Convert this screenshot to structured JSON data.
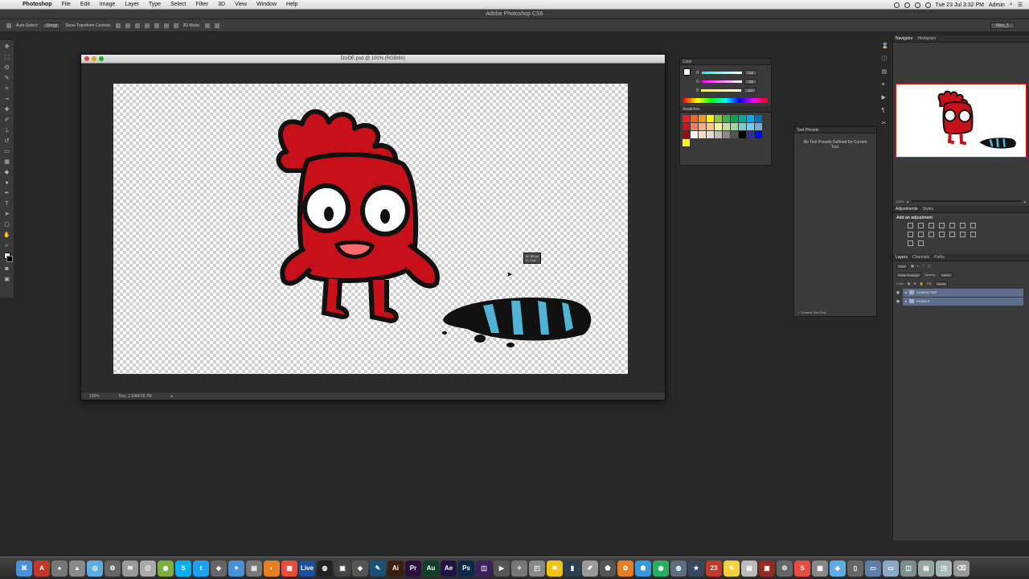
{
  "menubar": {
    "app_name": "Photoshop",
    "items": [
      "File",
      "Edit",
      "Image",
      "Layer",
      "Type",
      "Select",
      "Filter",
      "3D",
      "View",
      "Window",
      "Help"
    ],
    "clock": "Tue 23 Jul  3:32 PM",
    "user": "Admin"
  },
  "app_title": "Adobe Photoshop CS6",
  "options_bar": {
    "auto_select": "Auto-Select:",
    "auto_select_value": "Group",
    "show_transform": "Show Transform Controls",
    "mode_3d": "3D Mode:",
    "workspace": "Misc_1"
  },
  "document": {
    "title": "DUDE.psd @ 100% (RGB/8#)",
    "zoom": "100%",
    "doc_size": "Doc: 2.64M/18.7M",
    "readout_w": "W: 96 px",
    "readout_h": "H: 1 px"
  },
  "color_panel": {
    "tab_label": "Color",
    "r_label": "R",
    "r_value": "255",
    "g_label": "G",
    "g_value": "255",
    "b_label": "B",
    "b_value": "255",
    "swatches_label": "Swatches",
    "swatches": [
      "#ec1c24",
      "#f26522",
      "#f7941d",
      "#fff200",
      "#8dc63f",
      "#39b54a",
      "#00a651",
      "#00a99d",
      "#00aeef",
      "#0072bc",
      "#c4161c",
      "#e6845e",
      "#f9ad81",
      "#fdc689",
      "#fff799",
      "#c4df9b",
      "#a3d39c",
      "#7accc8",
      "#6dcff6",
      "#7da7d9",
      "#9e0b0f",
      "#ffffff",
      "#f2e1c9",
      "#dedcda",
      "#bdbcbb",
      "#8a8988",
      "#555454",
      "#000000",
      "#2e3192",
      "#0000ff",
      "#ffff00"
    ]
  },
  "tool_presets": {
    "tab_label": "Tool Presets",
    "empty_message": "No Tool Presets Defined for Current Tool.",
    "current_only": "Current Tool Only"
  },
  "navigator": {
    "tabs": [
      "Navigator",
      "Histogram"
    ],
    "zoom": "100%"
  },
  "adjustments": {
    "tabs": [
      "Adjustments",
      "Styles"
    ],
    "title": "Add an adjustment"
  },
  "layers": {
    "tabs": [
      "Layers",
      "Channels",
      "Paths"
    ],
    "kind": "Kind",
    "blend_mode": "Pass Through",
    "opacity_label": "Opacity:",
    "opacity": "100%",
    "lock_label": "Lock:",
    "fill_label": "Fill:",
    "fill": "100%",
    "items": [
      "CHARACTER",
      "PUDDLE"
    ]
  },
  "dock": {
    "apps": [
      {
        "label": "⌘",
        "color": "#4a90d9"
      },
      {
        "label": "A",
        "color": "#c0392b"
      },
      {
        "label": "●",
        "color": "#777777"
      },
      {
        "label": "▲",
        "color": "#888888"
      },
      {
        "label": "◎",
        "color": "#5dade2"
      },
      {
        "label": "⚙",
        "color": "#666666"
      },
      {
        "label": "✉",
        "color": "#999999"
      },
      {
        "label": "@",
        "color": "#aaaaaa"
      },
      {
        "label": "◉",
        "color": "#7dae3c"
      },
      {
        "label": "S",
        "color": "#00aff0"
      },
      {
        "label": "t",
        "color": "#1da1f2"
      },
      {
        "label": "◆",
        "color": "#666666"
      },
      {
        "label": "✦",
        "color": "#4a90d9"
      },
      {
        "label": "▤",
        "color": "#777777"
      },
      {
        "label": "◐",
        "color": "#e67e22"
      },
      {
        "label": "▦",
        "color": "#e74c3c"
      },
      {
        "label": "Live",
        "color": "#1c4fa0"
      },
      {
        "label": "◍",
        "color": "#222222"
      },
      {
        "label": "▣",
        "color": "#444444"
      },
      {
        "label": "◈",
        "color": "#555555"
      },
      {
        "label": "✎",
        "color": "#1a5276"
      },
      {
        "label": "Ai",
        "color": "#3b1f0f"
      },
      {
        "label": "Pr",
        "color": "#2c0f3f"
      },
      {
        "label": "Au",
        "color": "#0f3f2c"
      },
      {
        "label": "Ae",
        "color": "#1f1444"
      },
      {
        "label": "Ps",
        "color": "#0b2a4a"
      },
      {
        "label": "◫",
        "color": "#3d1f5c"
      },
      {
        "label": "▶",
        "color": "#555555"
      },
      {
        "label": "✧",
        "color": "#777777"
      },
      {
        "label": "◰",
        "color": "#888888"
      },
      {
        "label": "✉",
        "color": "#f1c40f"
      },
      {
        "label": "▮",
        "color": "#2c3e50"
      },
      {
        "label": "✐",
        "color": "#999999"
      },
      {
        "label": "⬟",
        "color": "#555555"
      },
      {
        "label": "✿",
        "color": "#e67e22"
      },
      {
        "label": "⬢",
        "color": "#3498db"
      },
      {
        "label": "◉",
        "color": "#27ae60"
      },
      {
        "label": "◍",
        "color": "#5d6d7e"
      },
      {
        "label": "★",
        "color": "#34495e"
      },
      {
        "label": "23",
        "color": "#c0392b"
      },
      {
        "label": "✎",
        "color": "#f4d03f"
      },
      {
        "label": "▤",
        "color": "#bbbbbb"
      },
      {
        "label": "▣",
        "color": "#922b21"
      },
      {
        "label": "⚙",
        "color": "#666666"
      },
      {
        "label": "S",
        "color": "#e74c3c"
      },
      {
        "label": "▦",
        "color": "#888888"
      },
      {
        "label": "◆",
        "color": "#5dade2"
      },
      {
        "label": "▯",
        "color": "#666666"
      },
      {
        "label": "▭",
        "color": "#5b7fa8"
      },
      {
        "label": "▭",
        "color": "#8aa9c9"
      },
      {
        "label": "◫",
        "color": "#7f8c8d"
      },
      {
        "label": "▤",
        "color": "#95a5a6"
      },
      {
        "label": "◳",
        "color": "#aab7b8"
      },
      {
        "label": "⌫",
        "color": "#999999"
      }
    ]
  }
}
